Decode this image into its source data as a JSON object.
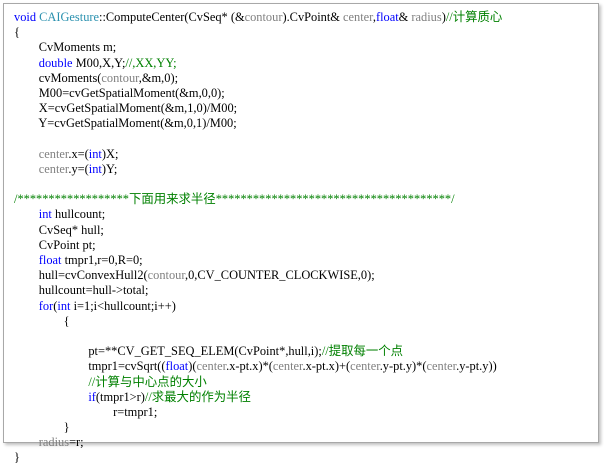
{
  "code_lines": [
    [
      {
        "t": "void",
        "c": "k"
      },
      {
        "t": " "
      },
      {
        "t": "CAIGesture",
        "c": "t"
      },
      {
        "t": "::ComputeCenter(CvSeq* (&"
      },
      {
        "t": "contour",
        "c": "g"
      },
      {
        "t": ").CvPoint& "
      },
      {
        "t": "center",
        "c": "g"
      },
      {
        "t": ","
      },
      {
        "t": "float",
        "c": "k"
      },
      {
        "t": "& "
      },
      {
        "t": "radius",
        "c": "g"
      },
      {
        "t": ")"
      },
      {
        "t": "//计算质心",
        "c": "c"
      }
    ],
    [
      {
        "t": "{"
      }
    ],
    [
      {
        "t": "        CvMoments m;"
      }
    ],
    [
      {
        "t": "        "
      },
      {
        "t": "double",
        "c": "k"
      },
      {
        "t": " M00,X,Y;"
      },
      {
        "t": "//,XX,YY;",
        "c": "c"
      }
    ],
    [
      {
        "t": "        cvMoments("
      },
      {
        "t": "contour",
        "c": "g"
      },
      {
        "t": ",&m,0);"
      }
    ],
    [
      {
        "t": "        M00=cvGetSpatialMoment(&m,0,0);"
      }
    ],
    [
      {
        "t": "        X=cvGetSpatialMoment(&m,1,0)/M00;"
      }
    ],
    [
      {
        "t": "        Y=cvGetSpatialMoment(&m,0,1)/M00;"
      }
    ],
    [
      {
        "t": ""
      }
    ],
    [
      {
        "t": "        "
      },
      {
        "t": "center",
        "c": "g"
      },
      {
        "t": ".x=("
      },
      {
        "t": "int",
        "c": "k"
      },
      {
        "t": ")X;"
      }
    ],
    [
      {
        "t": "        "
      },
      {
        "t": "center",
        "c": "g"
      },
      {
        "t": ".y=("
      },
      {
        "t": "int",
        "c": "k"
      },
      {
        "t": ")Y;"
      }
    ],
    [
      {
        "t": ""
      }
    ],
    [
      {
        "t": "/******************下面用来求半径**************************************/",
        "c": "c"
      }
    ],
    [
      {
        "t": "        "
      },
      {
        "t": "int",
        "c": "k"
      },
      {
        "t": " hullcount;"
      }
    ],
    [
      {
        "t": "        CvSeq* hull;"
      }
    ],
    [
      {
        "t": "        CvPoint pt;"
      }
    ],
    [
      {
        "t": "        "
      },
      {
        "t": "float",
        "c": "k"
      },
      {
        "t": " tmpr1,r=0,R=0;"
      }
    ],
    [
      {
        "t": "        hull=cvConvexHull2("
      },
      {
        "t": "contour",
        "c": "g"
      },
      {
        "t": ",0,CV_COUNTER_CLOCKWISE,0);"
      }
    ],
    [
      {
        "t": "        hullcount=hull->total;"
      }
    ],
    [
      {
        "t": "        "
      },
      {
        "t": "for",
        "c": "k"
      },
      {
        "t": "("
      },
      {
        "t": "int",
        "c": "k"
      },
      {
        "t": " i=1;i<hullcount;i++)"
      }
    ],
    [
      {
        "t": "                {"
      }
    ],
    [
      {
        "t": ""
      }
    ],
    [
      {
        "t": "                        pt=**CV_GET_SEQ_ELEM(CvPoint*,hull,i);"
      },
      {
        "t": "//提取每一个点",
        "c": "c"
      }
    ],
    [
      {
        "t": "                        tmpr1=cvSqrt(("
      },
      {
        "t": "float",
        "c": "k"
      },
      {
        "t": ")("
      },
      {
        "t": "center",
        "c": "g"
      },
      {
        "t": ".x-pt.x)*("
      },
      {
        "t": "center",
        "c": "g"
      },
      {
        "t": ".x-pt.x)+("
      },
      {
        "t": "center",
        "c": "g"
      },
      {
        "t": ".y-pt.y)*("
      },
      {
        "t": "center",
        "c": "g"
      },
      {
        "t": ".y-pt.y))"
      }
    ],
    [
      {
        "t": "                        "
      },
      {
        "t": "//计算与中心点的大小",
        "c": "c"
      }
    ],
    [
      {
        "t": "                        "
      },
      {
        "t": "if",
        "c": "k"
      },
      {
        "t": "(tmpr1>r)"
      },
      {
        "t": "//求最大的作为半径",
        "c": "c"
      }
    ],
    [
      {
        "t": "                                r=tmpr1;"
      }
    ],
    [
      {
        "t": "                }"
      }
    ],
    [
      {
        "t": "        "
      },
      {
        "t": "radius",
        "c": "g"
      },
      {
        "t": "=r;"
      }
    ],
    [
      {
        "t": "}"
      }
    ]
  ]
}
